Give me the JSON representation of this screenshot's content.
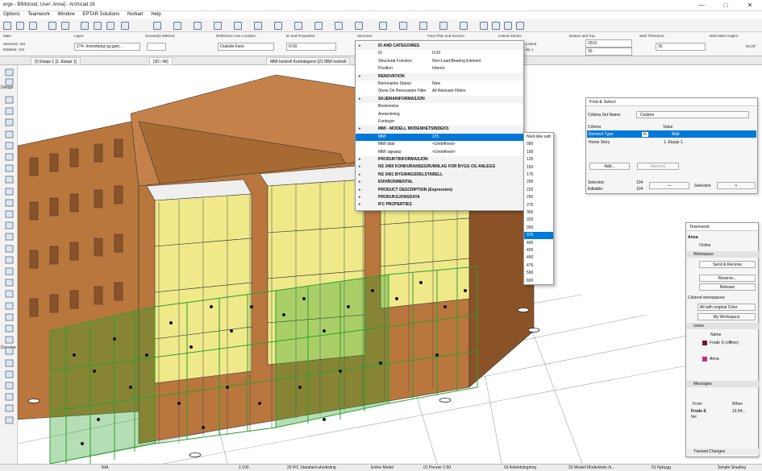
{
  "window": {
    "title": "erge - BIMcloud, User: Anna] - Archicad 26",
    "controls": [
      "—",
      "□",
      "✕"
    ]
  },
  "menu": [
    "Options",
    "Teamwork",
    "Window",
    "EPTAR Solutions",
    "Norkart",
    "Help"
  ],
  "infobox": {
    "main_label": "Main:",
    "selected": "Selected: 104",
    "editable": "Editable: 104",
    "layer_label": "Layer:",
    "layer_value": "274- Innredning og gam...",
    "geometry_label": "Geometry Method:",
    "refline_label": "Reference Line Location:",
    "refline_value": "Outside Face",
    "id_label": "ID and Properties:",
    "id_value": "IV10",
    "structure_label": "Structure:",
    "floorplan_label": "Floor Plan and Section:",
    "linked_label": "Linked Stories:",
    "linked_value": "Linked",
    "linked_sub": "ely 1.",
    "topbottom_label": "Bottom and Top:",
    "top_value": "2510",
    "bottom_value": "30",
    "thickness_label": "Wall Thickness:",
    "thickness_value": "30",
    "slant_label": "Wall Slant Angles:",
    "slant_value": "90,00°"
  },
  "tabs": [
    "(I) Etasje 1 [1. Etasje 1]",
    "[3D / All]",
    "MMI kontroll Kontrakgorer [21 MMI kontroll"
  ],
  "toolbox": {
    "design_label": "Design",
    "document_label": "Docume"
  },
  "dropdown": {
    "rows": [
      {
        "kind": "head",
        "key": "ID AND CATEGORIES",
        "value": ""
      },
      {
        "kind": "row",
        "key": "ID",
        "value": "IV10"
      },
      {
        "kind": "row",
        "key": "Structural Function",
        "value": "Non-Load-Bearing Element"
      },
      {
        "kind": "row",
        "key": "Position",
        "value": "Interior"
      },
      {
        "kind": "head",
        "key": "RENOVATION",
        "value": ""
      },
      {
        "kind": "row",
        "key": "Renovation Status",
        "value": "New"
      },
      {
        "kind": "row",
        "key": "Show On Renovation Filter",
        "value": "All Relevant Filters"
      },
      {
        "kind": "head",
        "key": "SKJEMAINFORMASJON",
        "value": ""
      },
      {
        "kind": "row",
        "key": "Beskrivelse",
        "value": ""
      },
      {
        "kind": "row",
        "key": "Anmerkning",
        "value": ""
      },
      {
        "kind": "row",
        "key": "Funksjon",
        "value": ""
      },
      {
        "kind": "head",
        "key": "MMI - MODELL MODENHETSINDEKS",
        "value": ""
      },
      {
        "kind": "sel",
        "key": "MMI",
        "value": "375"
      },
      {
        "kind": "row",
        "key": "MMI dato",
        "value": "<Undefined>"
      },
      {
        "kind": "row",
        "key": "MMI signatur",
        "value": "<Undefined>"
      },
      {
        "kind": "head",
        "key": "PRODUKTINFORMASJON",
        "value": ""
      },
      {
        "kind": "head",
        "key": "NS 3450 KONKURANSEGRUNNLAG FOR BYGG OG ANLEGG",
        "value": ""
      },
      {
        "kind": "head",
        "key": "NS 3451 BYGNINGSDELSTABELL",
        "value": ""
      },
      {
        "kind": "head",
        "key": "ENVIRONMENTAL",
        "value": ""
      },
      {
        "kind": "head",
        "key": "PRODUCT DESCRIPTION (Expression)",
        "value": ""
      },
      {
        "kind": "head",
        "key": "PRODUKSJONSDATA",
        "value": ""
      },
      {
        "kind": "head",
        "key": "IFC PROPERTIES",
        "value": ""
      }
    ]
  },
  "submenu": {
    "items": [
      "Nivå ikke satt",
      "000",
      "100",
      "125",
      "150",
      "175",
      "200",
      "225",
      "250",
      "275",
      "300",
      "325",
      "350",
      "375",
      "400",
      "425",
      "450",
      "475",
      "500",
      "600"
    ],
    "selected": "375"
  },
  "find_select": {
    "title": "Find & Select",
    "criteria_set_label": "Criteria Set Name:",
    "criteria_set_value": "Custom",
    "col_criteria": "Criteria",
    "col_value": "Value",
    "rows": [
      {
        "criteria": "Element Type",
        "op": "is",
        "value": "Wall"
      },
      {
        "criteria": "Home Story",
        "op": "",
        "value": "1. Etasje 1."
      }
    ],
    "add_button": "Add...",
    "remove_button": "Remove",
    "selected_label": "Selected:",
    "selected_value": "104",
    "editable_label": "Editable:",
    "editable_value": "104",
    "minus_button": "—",
    "selection_label": "Selection",
    "plus_button": "+"
  },
  "teamwork": {
    "title": "Teamwork",
    "user": "Anna",
    "status": "Online",
    "workspace_header": "Workspace",
    "send_receive": "Send & Receive",
    "reserve": "Reserve...",
    "release": "Release",
    "colored_label": "Colored workspaces:",
    "colored_value": "All with original Color",
    "my_workspace": "My Workspace",
    "users_header": "Users",
    "name_label": "Name",
    "users": [
      {
        "name": "Frode S (offline)",
        "color": "#6b1a2a"
      },
      {
        "name": "Anna",
        "color": "#c2307a"
      }
    ],
    "messages_header": "Messages",
    "msg_from": "From",
    "msg_when": "When",
    "msg_sender": "Frode S",
    "msg_time": "15:54...",
    "msg_text": "hei",
    "tracked_changes": "Tracked Changes"
  },
  "statusbar": {
    "zoom": "N/A",
    "scale": "1:100",
    "view": "20 IFC Standard-utveksling",
    "model": "Entire Model",
    "pen": "01 Penner 1:50",
    "work": "03 Arbeidstegning",
    "mvo": "22 Modell Modenhets In...",
    "renovation": "01 Nybygg",
    "shading": "Simple Shading"
  },
  "colors": {
    "accent": "#0078d7",
    "brick": "#b9763d",
    "brick_dark": "#8a5327",
    "balcony_yellow": "#efe98a",
    "selection_green": "#2aa02a"
  }
}
